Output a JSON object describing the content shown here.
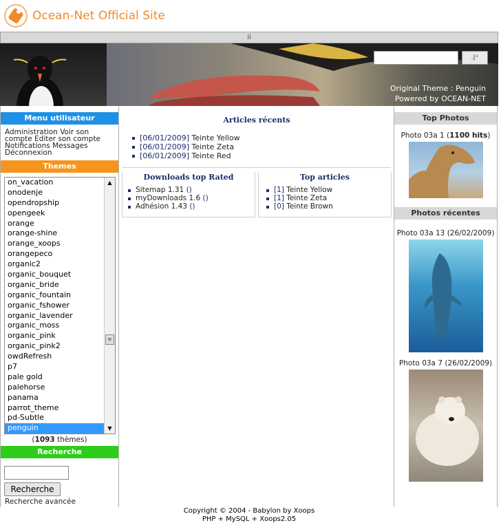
{
  "site": {
    "title": "Ocean-Net Official Site",
    "subbar_text": "ii"
  },
  "banner": {
    "search_button_label": "",
    "credit_line1": "Original Theme : Penguin",
    "credit_line2": "Powered by OCEAN-NET"
  },
  "user_menu": {
    "title": "Menu utilisateur",
    "items": [
      "Administration",
      "Voir son compte",
      "Editer son compte",
      "Notifications",
      "Messages",
      "Déconnexion"
    ]
  },
  "themes": {
    "title": "Themes",
    "items": [
      "on_vacation",
      "onodenje",
      "opendropship",
      "opengeek",
      "orange",
      "orange-shine",
      "orange_xoops",
      "orangepeco",
      "organic2",
      "organic_bouquet",
      "organic_bride",
      "organic_fountain",
      "organic_fshower",
      "organic_lavender",
      "organic_moss",
      "organic_pink",
      "organic_pink2",
      "owdRefresh",
      "p7",
      "pale gold",
      "palehorse",
      "panama",
      "parrot_theme",
      "pd-Subtle",
      "penguin"
    ],
    "selected": "penguin",
    "count": "1093",
    "count_suffix": "thèmes"
  },
  "search": {
    "title": "Recherche",
    "button_label": "Recherche",
    "advanced_link": "Recherche avancée"
  },
  "recent_articles": {
    "title": "Articles récents",
    "items": [
      {
        "date": "[06/01/2009]",
        "title": "Teinte Yellow"
      },
      {
        "date": "[06/01/2009]",
        "title": "Teinte Zeta"
      },
      {
        "date": "[06/01/2009]",
        "title": "Teinte Red"
      }
    ]
  },
  "downloads_top_rated": {
    "title": "Downloads top Rated",
    "items": [
      {
        "name": "Sitemap 1.31",
        "score": "()"
      },
      {
        "name": "myDownloads 1.6",
        "score": "()"
      },
      {
        "name": "Adhésion 1.43",
        "score": "()"
      }
    ]
  },
  "top_articles": {
    "title": "Top articles",
    "items": [
      {
        "count": "[1]",
        "title": "Teinte Yellow"
      },
      {
        "count": "[1]",
        "title": "Teinte Zeta"
      },
      {
        "count": "[0]",
        "title": "Teinte Brown"
      }
    ]
  },
  "top_photos": {
    "title": "Top Photos",
    "caption_name": "Photo 03a 1",
    "caption_hits": "1100 hits"
  },
  "recent_photos": {
    "title": "Photos récentes",
    "items": [
      {
        "name": "Photo 03a 13",
        "date": "(26/02/2009)"
      },
      {
        "name": "Photo 03a 7",
        "date": "(26/02/2009)"
      }
    ]
  },
  "footer": {
    "line1": "Copyright © 2004 - Babylon by Xoops",
    "line2": "PHP + MySQL + Xoops2.05"
  },
  "colors": {
    "accent_orange": "#f7941d",
    "menu_blue": "#1e90e6",
    "search_green": "#2ecc1a",
    "link_navy": "#1c2c6b",
    "selected_blue": "#3399ff"
  }
}
